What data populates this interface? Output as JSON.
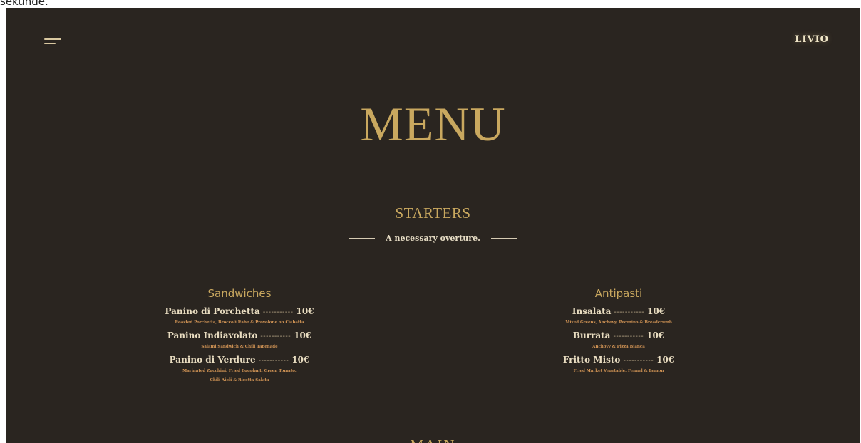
{
  "top_text": "sekunde.",
  "header": {
    "brand": "LIVIO"
  },
  "hero": {
    "title": "MENU"
  },
  "section": {
    "title": "STARTERS",
    "tagline": "A necessary overture."
  },
  "columns": [
    {
      "title": "Sandwiches",
      "items": [
        {
          "name": "Panino di Porchetta",
          "dots": "-----------",
          "price": "10€",
          "desc": [
            "Roasted Porchetta, Broccoli Rabe & Provolone on Ciabatta"
          ]
        },
        {
          "name": "Panino Indiavolato",
          "dots": "-----------",
          "price": "10€",
          "desc": [
            "Salami Sandwich & Chili Tapenade"
          ]
        },
        {
          "name": "Panino di Verdure",
          "dots": "-----------",
          "price": "10€",
          "desc": [
            "Marinated Zucchini, Fried Eggplant, Green Tomato,",
            "Chili Aioli & Ricotta Salata"
          ]
        }
      ]
    },
    {
      "title": "Antipasti",
      "items": [
        {
          "name": "Insalata",
          "dots": "-----------",
          "price": "10€",
          "desc": [
            "Mixed Greens, Anchovy, Pecorino & Breadcrumb"
          ]
        },
        {
          "name": "Burrata",
          "dots": "-----------",
          "price": "10€",
          "desc": [
            "Anchovy & Pizza Bianca"
          ]
        },
        {
          "name": "Fritto Misto",
          "dots": "-----------",
          "price": "10€",
          "desc": [
            "Fried Market Vegetable, Fennel & Lemon"
          ]
        }
      ]
    }
  ],
  "next_section": {
    "title": "MAIN"
  },
  "colors": {
    "background": "#2a2520",
    "gold": "#c9a85f",
    "cream": "#e8dcc0",
    "accent_desc": "#d19455"
  },
  "icons": {
    "menu": "hamburger-menu-icon"
  }
}
